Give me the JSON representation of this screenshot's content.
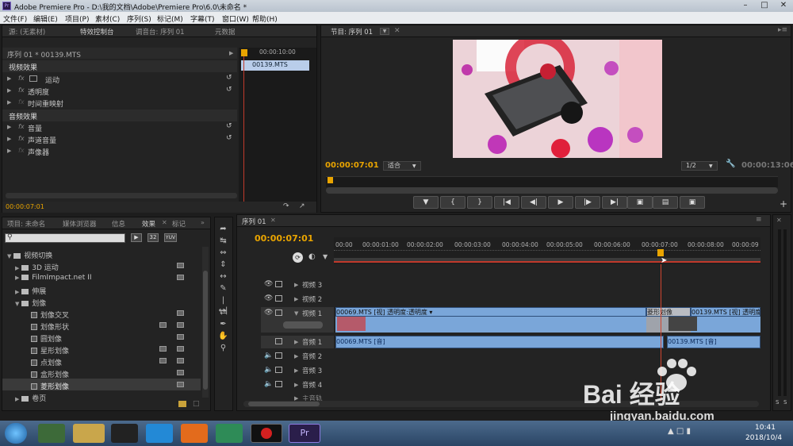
{
  "window": {
    "title": "Adobe Premiere Pro - D:\\我的文档\\Adobe\\Premiere Pro\\6.0\\未命名 *",
    "app_icon": "Pr"
  },
  "menu": [
    "文件(F)",
    "编辑(E)",
    "项目(P)",
    "素材(C)",
    "序列(S)",
    "标记(M)",
    "字幕(T)",
    "窗口(W)",
    "帮助(H)"
  ],
  "source_panel": {
    "tabs": [
      "源: (无素材)",
      "特效控制台",
      "调音台: 序列 01",
      "元数据"
    ],
    "header": "序列 01 * 00139.MTS",
    "mini_ruler_time": "00:00:10:00",
    "mini_clip": "00139.MTS",
    "video_effects_header": "视频效果",
    "video_effects": [
      "运动",
      "透明度",
      "时间重映射"
    ],
    "audio_effects_header": "音频效果",
    "audio_effects": [
      "音量",
      "声道音量",
      "声像器"
    ],
    "timecode": "00:00:07:01"
  },
  "program_monitor": {
    "tab": "节目: 序列 01",
    "timecode": "00:00:07:01",
    "fit": "适合",
    "resolution": "1/2",
    "duration": "00:00:13:06"
  },
  "project_panel": {
    "tabs": [
      "项目: 未命名",
      "媒体浏览器",
      "信息",
      "效果",
      "标记"
    ],
    "search_placeholder": "",
    "tags": [
      "32",
      "YUV"
    ],
    "tree": [
      {
        "label": "视频切换",
        "level": 0,
        "open": true
      },
      {
        "label": "3D 运动",
        "level": 1
      },
      {
        "label": "FilmImpact.net II",
        "level": 1
      },
      {
        "label": "伸展",
        "level": 1
      },
      {
        "label": "划像",
        "level": 1,
        "open": true
      },
      {
        "label": "划像交叉",
        "level": 2
      },
      {
        "label": "划像形状",
        "level": 2
      },
      {
        "label": "圆划像",
        "level": 2
      },
      {
        "label": "星形划像",
        "level": 2
      },
      {
        "label": "点划像",
        "level": 2
      },
      {
        "label": "盒形划像",
        "level": 2
      },
      {
        "label": "菱形划像",
        "level": 2,
        "selected": true
      },
      {
        "label": "卷页",
        "level": 1
      }
    ]
  },
  "timeline": {
    "tab": "序列 01",
    "timecode": "00:00:07:01",
    "ruler": [
      "00:00",
      "00:00:01:00",
      "00:00:02:00",
      "00:00:03:00",
      "00:00:04:00",
      "00:00:05:00",
      "00:00:06:00",
      "00:00:07:00",
      "00:00:08:00",
      "00:00:09"
    ],
    "tracks": [
      "视频 3",
      "视频 2",
      "视频 1",
      "音频 1",
      "音频 2",
      "音频 3",
      "音频 4",
      "主音轨"
    ],
    "v1_clip_a": "00069.MTS [视] 透明度:透明度 ▾",
    "v1_transition": "菱形划像",
    "v1_clip_b": "00139.MTS [视] 透明度",
    "a1_clip_a": "00069.MTS [音]",
    "a1_clip_b": "00139.MTS [音]"
  },
  "watermark": {
    "brand": "Bai 经验",
    "url": "jingyan.baidu.com"
  },
  "taskbar": {
    "time": "10:41",
    "date": "2018/10/4"
  }
}
